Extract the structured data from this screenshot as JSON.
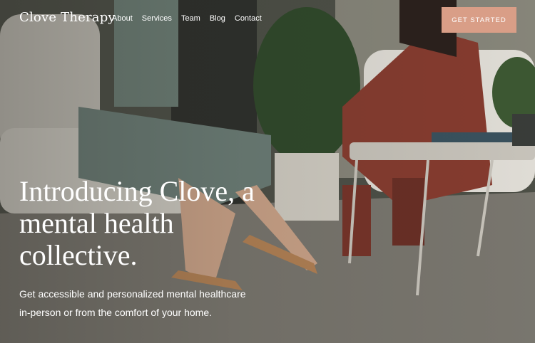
{
  "header": {
    "logo": "Clove Therapy",
    "nav": [
      "About",
      "Services",
      "Team",
      "Blog",
      "Contact"
    ],
    "cta_label": "GET STARTED"
  },
  "hero": {
    "headline": "Introducing Clove, a mental health collective.",
    "subtext": "Get accessible and personalized mental healthcare in-person or from the comfort of your home."
  },
  "colors": {
    "accent": "#d99e87",
    "text": "#ffffff"
  }
}
